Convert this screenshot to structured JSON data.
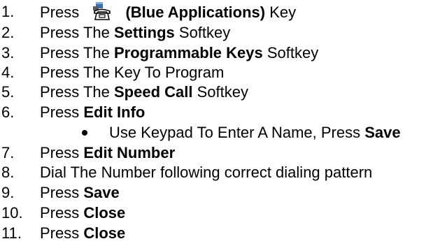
{
  "steps": [
    {
      "number": "1.",
      "parts": [
        {
          "t": "Press ",
          "b": false
        },
        {
          "icon": "blue-applications-phone-icon"
        },
        {
          "t": " (Blue Applications)",
          "b": true
        },
        {
          "t": " Key",
          "b": false
        }
      ]
    },
    {
      "number": "2.",
      "parts": [
        {
          "t": "Press The ",
          "b": false
        },
        {
          "t": "Settings",
          "b": true
        },
        {
          "t": " Softkey",
          "b": false
        }
      ]
    },
    {
      "number": "3.",
      "parts": [
        {
          "t": "Press The ",
          "b": false
        },
        {
          "t": "Programmable Keys",
          "b": true
        },
        {
          "t": " Softkey",
          "b": false
        }
      ]
    },
    {
      "number": "4.",
      "parts": [
        {
          "t": "Press The Key To Program",
          "b": false
        }
      ]
    },
    {
      "number": "5.",
      "parts": [
        {
          "t": "Press The ",
          "b": false
        },
        {
          "t": "Speed Call",
          "b": true
        },
        {
          "t": " Softkey",
          "b": false
        }
      ]
    },
    {
      "number": "6.",
      "parts": [
        {
          "t": "Press ",
          "b": false
        },
        {
          "t": "Edit Info",
          "b": true
        }
      ]
    },
    {
      "number": "",
      "bullet": true,
      "parts": [
        {
          "t": "Use Keypad To Enter A Name, Press ",
          "b": false
        },
        {
          "t": "Save",
          "b": true
        }
      ]
    },
    {
      "number": "7.",
      "parts": [
        {
          "t": "Press ",
          "b": false
        },
        {
          "t": "Edit Number",
          "b": true
        }
      ]
    },
    {
      "number": "8.",
      "parts": [
        {
          "t": "Dial The Number following correct dialing pattern",
          "b": false
        }
      ]
    },
    {
      "number": "9.",
      "parts": [
        {
          "t": "Press ",
          "b": false
        },
        {
          "t": "Save",
          "b": true
        }
      ]
    },
    {
      "number": "10.",
      "parts": [
        {
          "t": "Press ",
          "b": false
        },
        {
          "t": "Close",
          "b": true
        }
      ]
    },
    {
      "number": "11.",
      "parts": [
        {
          "t": "Press ",
          "b": false
        },
        {
          "t": "Close",
          "b": true
        }
      ]
    }
  ]
}
